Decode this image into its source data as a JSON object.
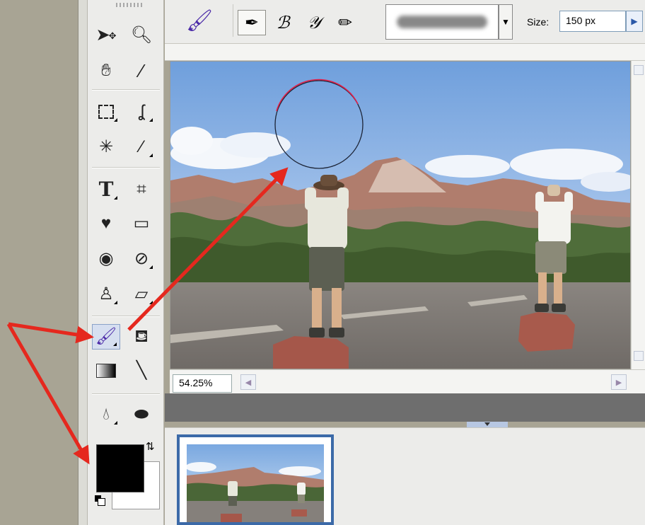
{
  "options_bar": {
    "size_label": "Size:",
    "size_value": "150 px",
    "modes": [
      "brush-icon",
      "impressionist-brush-icon",
      "color-replacement-icon",
      "pencil-icon"
    ],
    "dropdown_glyph": "▼",
    "stepper_glyph": "▶"
  },
  "tools": [
    "move-icon",
    "zoom-icon",
    "hand-icon",
    "eyedropper-icon",
    "marquee-icon",
    "lasso-icon",
    "magic-wand-icon",
    "selection-brush-icon",
    "type-icon",
    "crop-icon",
    "cookie-cutter-icon",
    "straighten-icon",
    "red-eye-icon",
    "healing-brush-icon",
    "clone-stamp-icon",
    "eraser-icon",
    "brush-icon",
    "paint-bucket-icon",
    "gradient-icon",
    "line-icon",
    "blur-icon",
    "sponge-icon"
  ],
  "selected_tool": "brush-icon",
  "type_tool_glyph": "T",
  "colors": {
    "foreground": "#000000",
    "background": "#ffffff",
    "accent": "#3c6aa8",
    "arrow": "#e5281e",
    "brush_cursor_top": "#e0204a"
  },
  "status": {
    "zoom": "54.25%"
  },
  "photo_bin": {
    "thumbnails": 1,
    "selected_thumbnail": 0
  }
}
